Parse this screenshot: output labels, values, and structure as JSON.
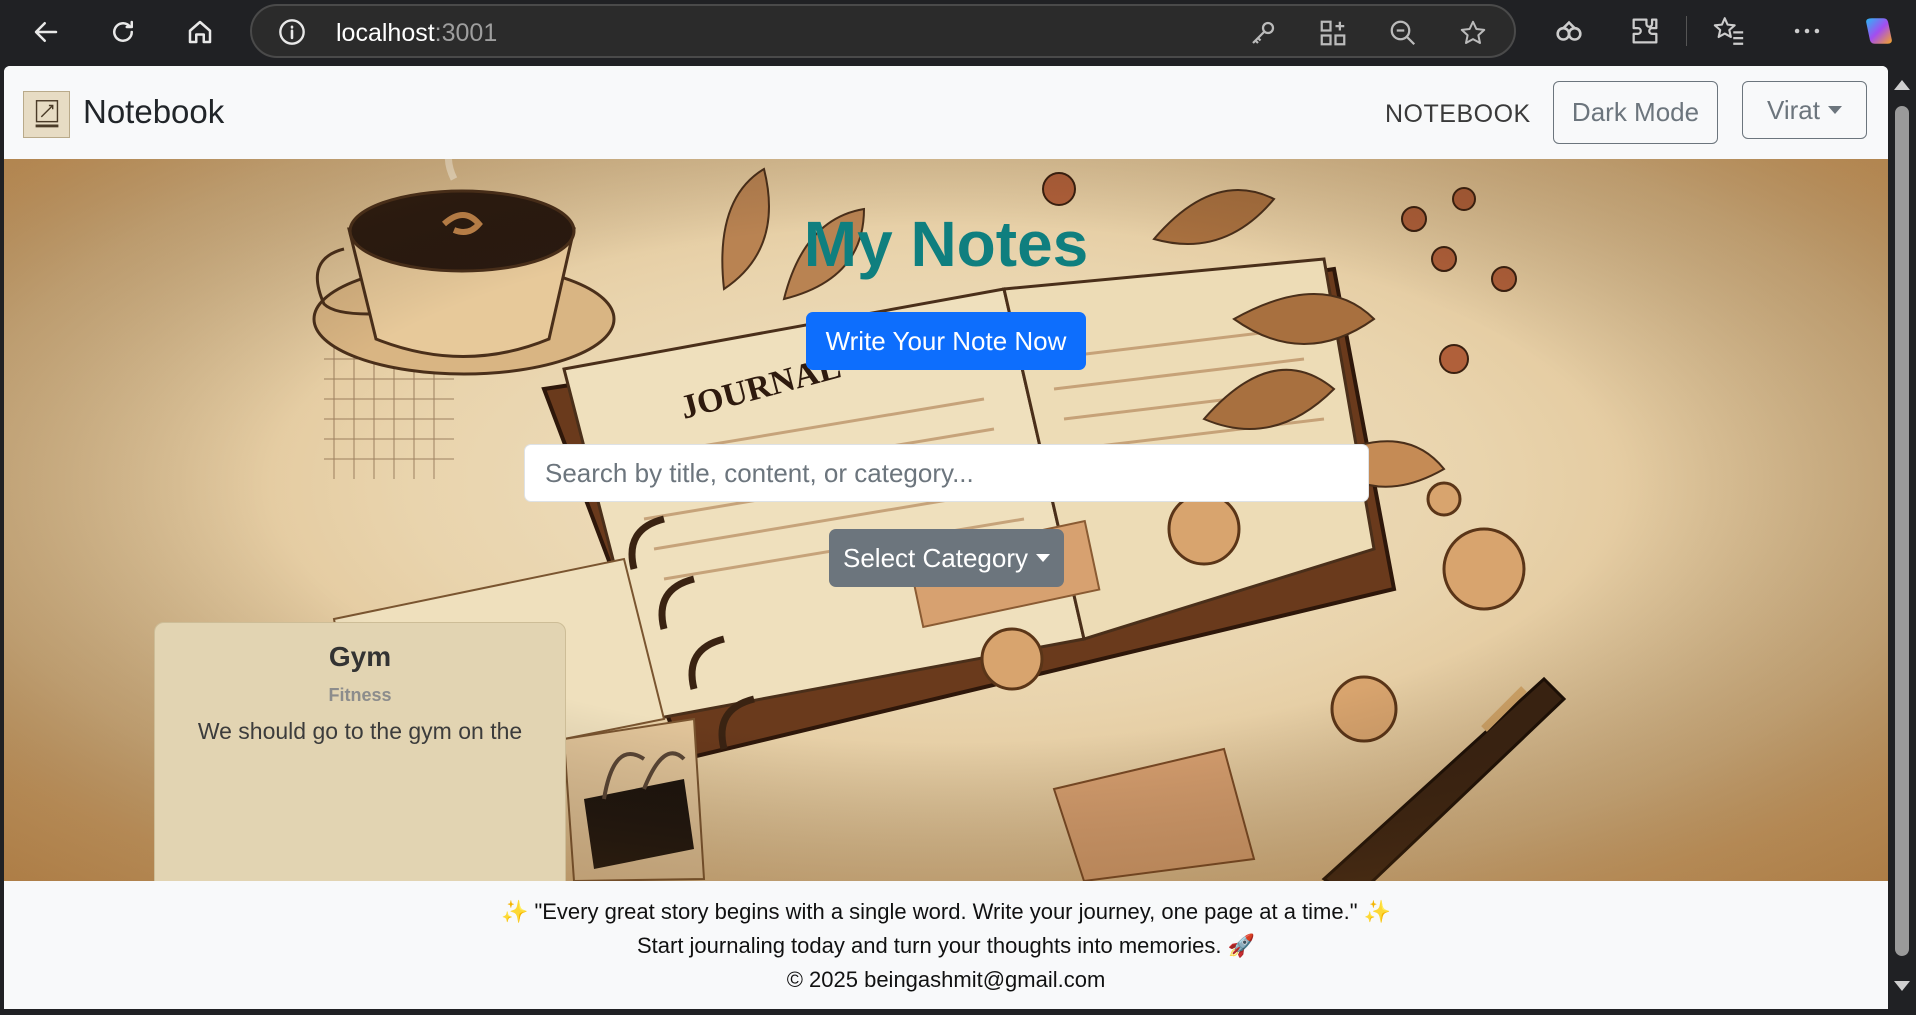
{
  "browser": {
    "url_host": "localhost",
    "url_port": ":3001"
  },
  "navbar": {
    "brand": "Notebook",
    "link": "NOTEBOOK",
    "dark_mode_label": "Dark Mode",
    "user_label": "Virat"
  },
  "hero": {
    "title": "My Notes",
    "write_button": "Write Your Note Now",
    "search_placeholder": "Search by title, content, or category...",
    "category_button": "Select Category"
  },
  "notes": [
    {
      "title": "Gym",
      "category": "Fitness",
      "body": "We should go to the gym on the"
    }
  ],
  "footer": {
    "quote": "✨ \"Every great story begins with a single word. Write your journey, one page at a time.\" ✨",
    "tagline": "Start journaling today and turn your thoughts into memories. 🚀",
    "copyright": "© 2025 beingashmit@gmail.com"
  },
  "colors": {
    "accent": "#0d6efd",
    "title": "#0f7f7f",
    "secondary": "#6c757d"
  }
}
